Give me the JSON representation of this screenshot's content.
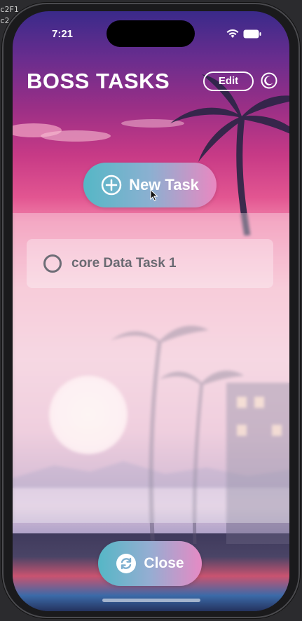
{
  "edge": {
    "line1": "c2F1",
    "line2": "c2"
  },
  "status_bar": {
    "time": "7:21"
  },
  "header": {
    "title": "BOSS TASKS",
    "edit_label": "Edit"
  },
  "actions": {
    "new_task_label": "New Task",
    "close_label": "Close"
  },
  "tasks": [
    {
      "label": "core Data Task 1",
      "completed": false
    }
  ],
  "icons": {
    "theme_toggle": "moon-icon",
    "new_task": "plus-circle-icon",
    "close": "refresh-circle-icon"
  },
  "colors": {
    "button_gradient_start": "#55b7c6",
    "button_gradient_end": "#e988c1",
    "title_text": "#ffffff",
    "task_text": "#6a6a72"
  }
}
